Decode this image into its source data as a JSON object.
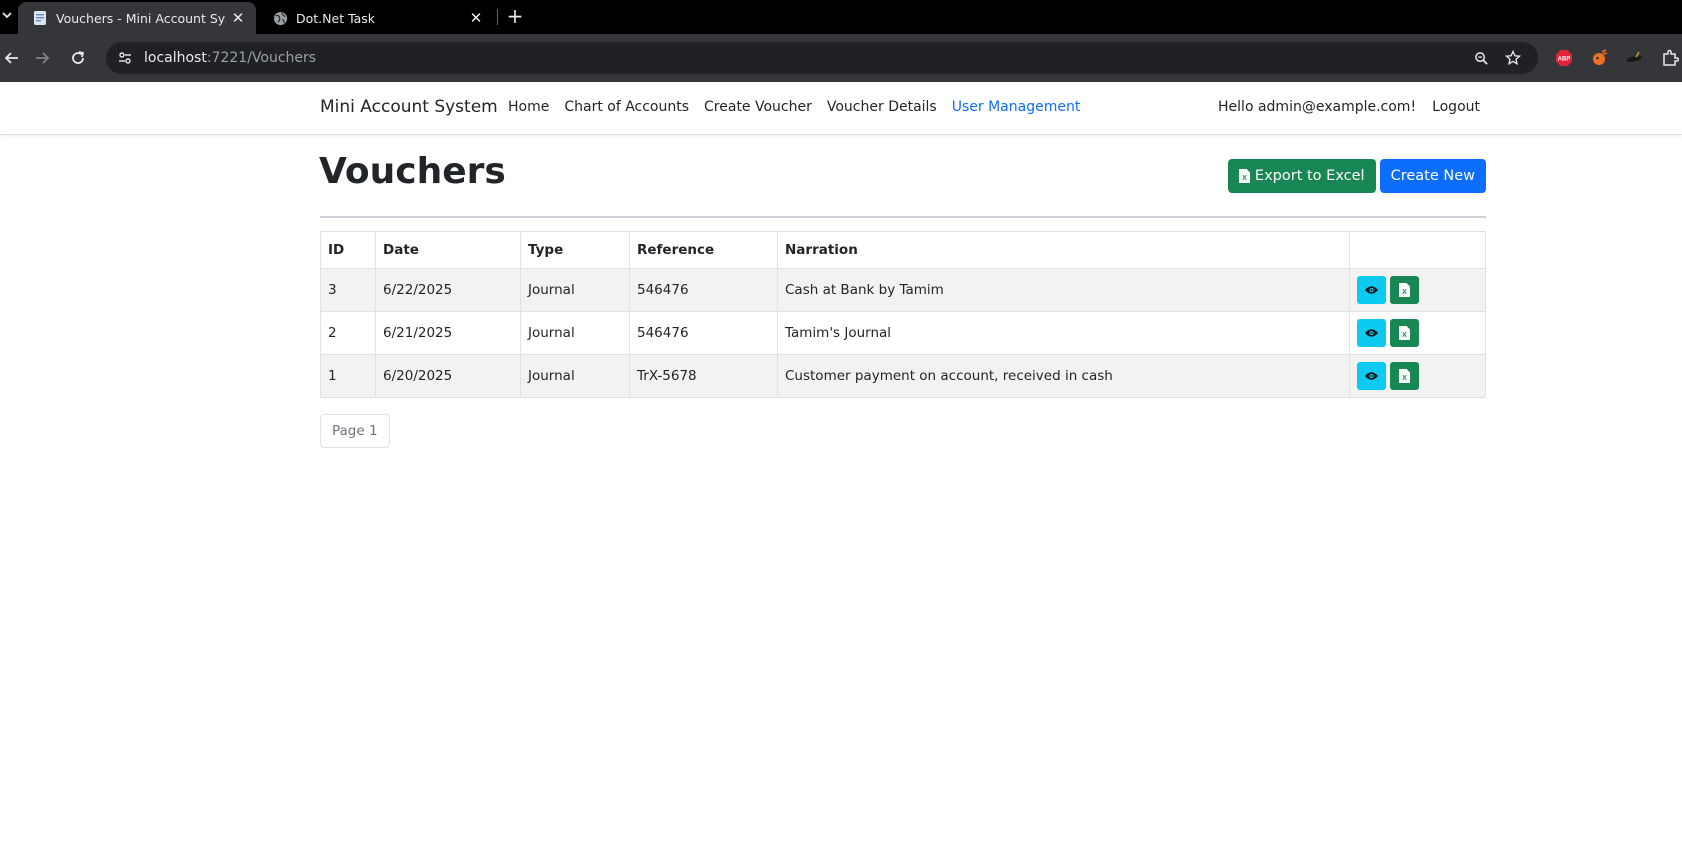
{
  "browser": {
    "tabs": [
      {
        "title": "Vouchers - Mini Account Systen",
        "active": true
      },
      {
        "title": "Dot.Net Task",
        "active": false
      }
    ],
    "url_host": "localhost",
    "url_rest": ":7221/Vouchers"
  },
  "nav": {
    "brand": "Mini Account System",
    "links": [
      "Home",
      "Chart of Accounts",
      "Create Voucher",
      "Voucher Details",
      "User Management"
    ],
    "greeting": "Hello admin@example.com!",
    "logout": "Logout"
  },
  "page": {
    "title": "Vouchers",
    "export_label": "Export to Excel",
    "create_label": "Create New"
  },
  "table": {
    "headers": [
      "ID",
      "Date",
      "Type",
      "Reference",
      "Narration",
      ""
    ],
    "rows": [
      [
        "3",
        "6/22/2025",
        "Journal",
        "546476",
        "Cash at Bank by Tamim"
      ],
      [
        "2",
        "6/21/2025",
        "Journal",
        "546476",
        "Tamim's Journal"
      ],
      [
        "1",
        "6/20/2025",
        "Journal",
        "TrX-5678",
        "Customer payment on account, received in cash"
      ]
    ]
  },
  "pager": {
    "label": "Page 1"
  },
  "colors": {
    "primary": "#0d6efd",
    "success": "#198754",
    "info": "#0dcaf0",
    "link_active": "#0d6efd"
  },
  "icons": {
    "tab_list": "chevron-down-icon",
    "tab_favicon": "document-icon",
    "tab2_favicon": "globe-icon",
    "back": "arrow-left-icon",
    "forward": "arrow-right-icon",
    "reload": "reload-icon",
    "site_info": "tune-icon",
    "zoom": "zoom-icon",
    "bookmark": "star-icon",
    "view": "eye-icon",
    "export": "excel-file-icon"
  }
}
